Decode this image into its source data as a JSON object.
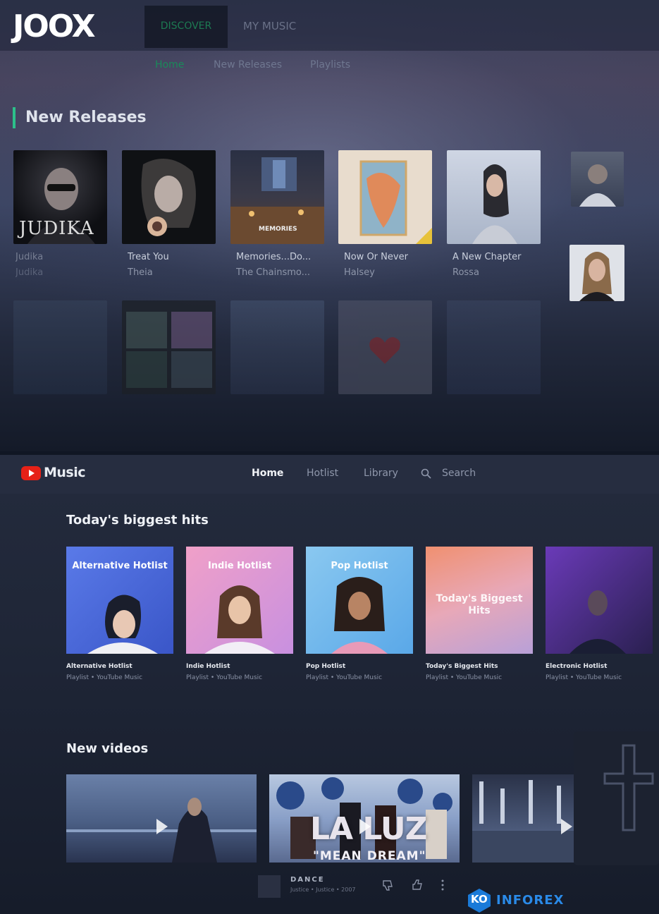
{
  "joox": {
    "logo": "JOOX",
    "top_tabs": [
      "DISCOVER",
      "MY MUSIC"
    ],
    "sub_tabs": [
      "Home",
      "New Releases",
      "Playlists"
    ],
    "section_title": "New Releases",
    "cards": [
      {
        "title": "Judika",
        "subtitle": "Judika",
        "art_text": "JUDIKA"
      },
      {
        "title": "Treat You",
        "subtitle": "Theia"
      },
      {
        "title": "Memories...Do...",
        "subtitle": "The Chainsmo...",
        "art_text": "MEMORIES"
      },
      {
        "title": "Now Or Never",
        "subtitle": "Halsey"
      },
      {
        "title": "A New Chapter",
        "subtitle": "Rossa"
      }
    ]
  },
  "ytm": {
    "brand": "Music",
    "nav": [
      "Home",
      "Hotlist",
      "Library"
    ],
    "search_label": "Search",
    "section1_title": "Today's biggest hits",
    "playlists": [
      {
        "art_label": "Alternative Hotlist",
        "title": "Alternative Hotlist",
        "subtitle": "Playlist • YouTube Music"
      },
      {
        "art_label": "Indie Hotlist",
        "title": "Indie Hotlist",
        "subtitle": "Playlist • YouTube Music"
      },
      {
        "art_label": "Pop Hotlist",
        "title": "Pop Hotlist",
        "subtitle": "Playlist • YouTube Music"
      },
      {
        "art_label": "Today's Biggest Hits",
        "title": "Today's Biggest Hits",
        "subtitle": "Playlist • YouTube Music"
      },
      {
        "art_label": "",
        "title": "Electronic Hotlist",
        "subtitle": "Playlist • YouTube Music"
      }
    ],
    "section2_title": "New videos",
    "videos": [
      {
        "overlay": ""
      },
      {
        "overlay": "LA LUZ",
        "overlay2": "\"MEAN DREAM\""
      },
      {
        "overlay": ""
      }
    ],
    "now_playing": {
      "title": "DANCE",
      "subtitle": "Justice • Justice • 2007"
    }
  },
  "watermark": {
    "prefix": "KO",
    "text": "INFOREX"
  },
  "colors": {
    "joox_accent": "#2cc08a",
    "youtube_red": "#e62117"
  }
}
